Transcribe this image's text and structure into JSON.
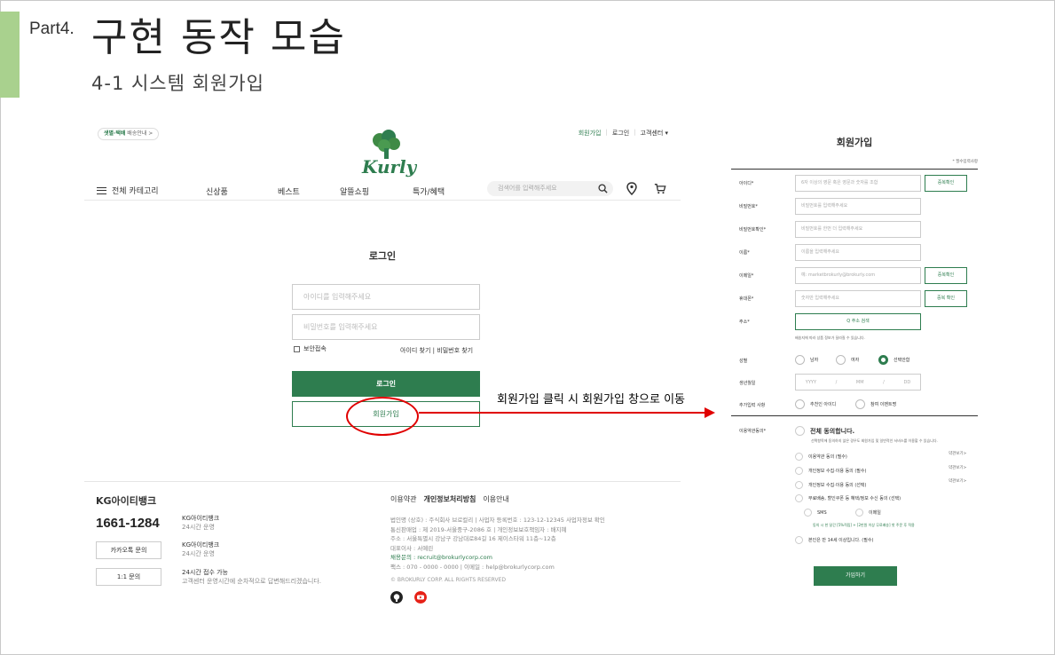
{
  "slide": {
    "part": "Part4.",
    "title": "구현 동작 모습",
    "subtitle": "4-1 시스템 회원가입",
    "annotation": "회원가입 클릭 시 회원가입 창으로 이동",
    "accent_color": "#a9d18e",
    "arrow_color": "#e00000"
  },
  "kurly": {
    "brand_color": "#2e7d4f",
    "delivery_badge": {
      "strong": "샛별·택배",
      "text": "배송안내 >"
    },
    "top_links": [
      "회원가입",
      "로그인",
      "고객센터 ▾"
    ],
    "logo_text": "Kurly",
    "nav": {
      "category": "전체 카테고리",
      "items": [
        "신상품",
        "베스트",
        "알뜰쇼핑",
        "특가/혜택"
      ],
      "search_placeholder": "검색어를 입력해주세요"
    },
    "login": {
      "title": "로그인",
      "id_placeholder": "아이디를 입력해주세요",
      "pw_placeholder": "비밀번호를 입력해주세요",
      "secure_label": "보안접속",
      "find_id": "아이디 찾기",
      "find_pw": "비밀번호 찾기",
      "login_button": "로그인",
      "join_button": "회원가입"
    },
    "footer": {
      "cs_title": "KG아이티뱅크",
      "phone": "1661-1284",
      "phone_desc": [
        "KG아이티뱅크",
        "24시간 운영"
      ],
      "kakao_button": "카카오톡 문의",
      "kakao_desc": [
        "KG아이티뱅크",
        "24시간 운영"
      ],
      "qna_button": "1:1 문의",
      "qna_desc": [
        "24시간 접수 가능",
        "고객센터 운영시간에 순차적으로 답변해드리겠습니다."
      ],
      "links": [
        "이용약관",
        "개인정보처리방침",
        "이용안내"
      ],
      "address_lines": [
        "법인명 (상호) : 주식회사 브로컬리  |  사업자 등록번호 : 123-12-12345 사업자정보 확인",
        "통신판매업 : 제 2019-서울중구-2086 호  |  개인정보보호책임자 : 배지혜",
        "주소 : 서울특별시 강남구 강남대로84길 16 제이스타워 11층~12층",
        "대표이사 : 서예린",
        "채용문의 : recruit@brokurlycorp.com",
        "팩스 : 070 - 0000 - 0000  |  이메일 : help@brokurlycorp.com"
      ],
      "copyright": "© BROKURLY CORP. ALL RIGHTS RESERVED"
    }
  },
  "signup": {
    "title": "회원가입",
    "required_note": "* 필수입력사항",
    "fields": [
      {
        "label": "아이디*",
        "placeholder": "6자 이상의 영문 혹은 영문과 숫자를 조합",
        "button": "중복확인"
      },
      {
        "label": "비밀번호*",
        "placeholder": "비밀번호를 입력해주세요"
      },
      {
        "label": "비밀번호확인*",
        "placeholder": "비밀번호를 한번 더 입력해주세요"
      },
      {
        "label": "이름*",
        "placeholder": "이름을 입력해주세요"
      },
      {
        "label": "이메일*",
        "placeholder": "예: marketbrokurly@brokurly.com",
        "button": "중복확인"
      },
      {
        "label": "휴대폰*",
        "placeholder": "숫자만 입력해주세요",
        "button": "중복 확인"
      }
    ],
    "address": {
      "label": "주소*",
      "button": "Q 주소 검색",
      "note": "배송지에 따라 상품 정보가 달라질 수 있습니다."
    },
    "gender": {
      "label": "성별",
      "options": [
        "남자",
        "여자",
        "선택안함"
      ],
      "selected": 2
    },
    "birth": {
      "label": "생년월일",
      "yyyy": "YYYY",
      "mm": "MM",
      "dd": "DD",
      "sep": "/"
    },
    "extra": {
      "label": "추가입력 사항",
      "options": [
        "추천인 아이디",
        "참여 이벤트명"
      ]
    },
    "terms": {
      "label": "이용약관동의*",
      "all": "전체 동의합니다.",
      "all_desc": "선택항목에 동의하지 않은 경우도 회원가입 및 일반적인 서비스를 이용할 수 있습니다.",
      "items": [
        {
          "text": "이용약관 동의 (필수)",
          "view": "약관보기>"
        },
        {
          "text": "개인정보 수집·이용 동의 (필수)",
          "view": "약관보기>"
        },
        {
          "text": "개인정보 수집·이용 동의 (선택)",
          "view": "약관보기>"
        },
        {
          "text": "무료배송, 할인쿠폰 등 혜택/정보 수신 동의 (선택)",
          "view": ""
        }
      ],
      "sms": "SMS",
      "email": "이메일",
      "benefit_note": "동의 시 한 달간 [5%적립] + [2만원 이상 무료배송] 첫 주문 후 적용",
      "age": "본인은 만 14세 이상입니다. (필수)"
    },
    "submit": "가입하기"
  }
}
